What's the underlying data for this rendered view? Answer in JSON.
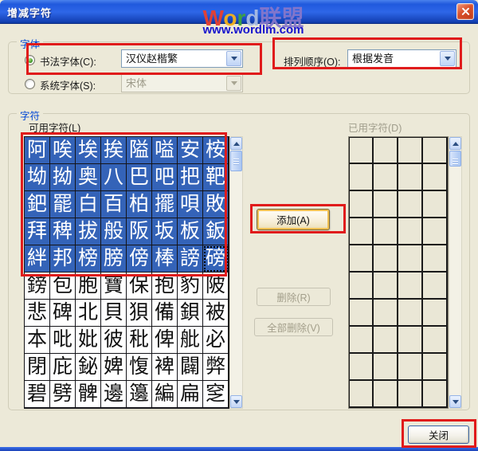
{
  "window": {
    "title": "增减字符"
  },
  "watermark": {
    "brand": [
      {
        "ch": "W",
        "color": "#e8402f"
      },
      {
        "ch": "o",
        "color": "#f5b21c"
      },
      {
        "ch": "r",
        "color": "#3fa53f"
      },
      {
        "ch": "d",
        "color": "#a9bce4"
      },
      {
        "ch": "联",
        "color": "#8577cb"
      },
      {
        "ch": "盟",
        "color": "#8577cb"
      }
    ],
    "url": "www.wordlm.com"
  },
  "font_group": {
    "label": "字体",
    "calligraphy": {
      "radio_label": "书法字体(C):",
      "value": "汉仪赵楷繁",
      "selected": true
    },
    "system": {
      "radio_label": "系统字体(S):",
      "value": "宋体",
      "selected": false
    },
    "sort": {
      "label": "排列顺序(O):",
      "value": "根据发音"
    }
  },
  "char_group": {
    "label": "字符",
    "available_label": "可用字符(L)",
    "used_label": "已用字符(D)",
    "available_rows": [
      [
        "阿",
        "唉",
        "埃",
        "挨",
        "隘",
        "嗌",
        "安",
        "桉"
      ],
      [
        "坳",
        "拗",
        "奥",
        "八",
        "巴",
        "吧",
        "把",
        "靶"
      ],
      [
        "鈀",
        "罷",
        "白",
        "百",
        "柏",
        "擺",
        "唄",
        "敗"
      ],
      [
        "拜",
        "稗",
        "拔",
        "般",
        "阪",
        "坂",
        "板",
        "鈑"
      ],
      [
        "絆",
        "邦",
        "榜",
        "膀",
        "傍",
        "棒",
        "謗",
        "磅"
      ],
      [
        "鎊",
        "包",
        "胞",
        "寶",
        "保",
        "抱",
        "豹",
        "陂"
      ],
      [
        "悲",
        "碑",
        "北",
        "貝",
        "狽",
        "備",
        "鋇",
        "被"
      ],
      [
        "本",
        "吡",
        "妣",
        "彼",
        "秕",
        "俾",
        "舭",
        "必"
      ],
      [
        "閉",
        "庇",
        "鉍",
        "婢",
        "愎",
        "裨",
        "闢",
        "弊"
      ],
      [
        "碧",
        "劈",
        "髀",
        "邊",
        "籩",
        "編",
        "扁",
        "窆"
      ]
    ],
    "selected_row_count": 5,
    "focused_cell": {
      "row": 4,
      "col": 7
    },
    "used_grid": {
      "rows": 10,
      "cols": 4
    }
  },
  "buttons": {
    "add": "添加(A)",
    "remove": "删除(R)",
    "remove_all": "全部删除(V)",
    "close": "关闭"
  },
  "colors": {
    "selection_blue": "#3463b8",
    "annotation_red": "#e01b1b",
    "dialog_bg": "#ece9d8",
    "group_label_blue": "#0046d5"
  }
}
